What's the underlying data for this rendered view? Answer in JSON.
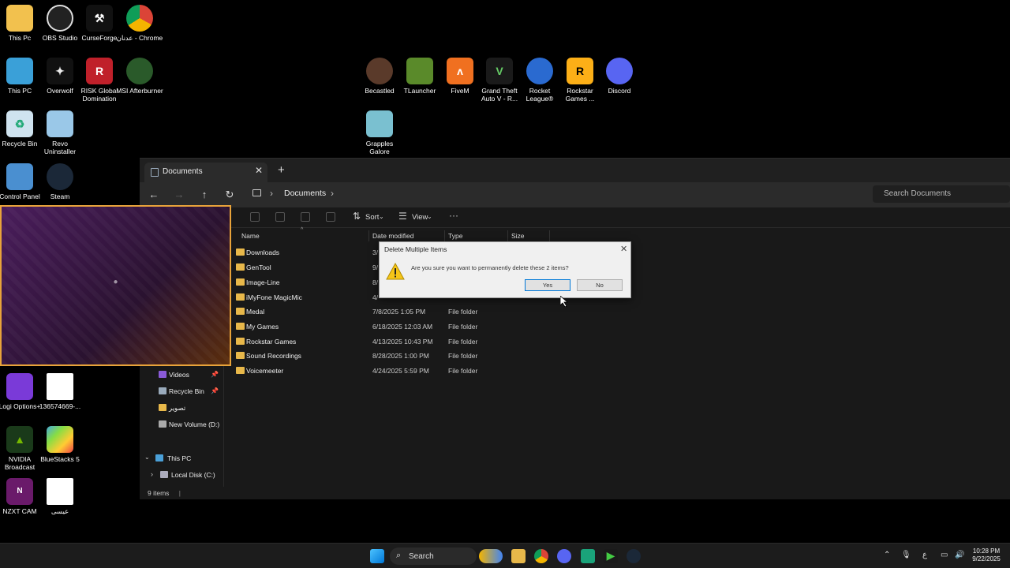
{
  "desktop": {
    "icons": [
      {
        "label": "This Pc"
      },
      {
        "label": "OBS Studio"
      },
      {
        "label": "CurseForge"
      },
      {
        "label": "عدنان - Chrome"
      },
      {
        "label": "This PC"
      },
      {
        "label": "Overwolf"
      },
      {
        "label": "RISK Global Domination"
      },
      {
        "label": "MSI Afterburner"
      },
      {
        "label": "Recycle Bin"
      },
      {
        "label": "Revo Uninstaller"
      },
      {
        "label": "Control Panel"
      },
      {
        "label": "Steam"
      },
      {
        "label": "Logi Options+"
      },
      {
        "label": "136574669-..."
      },
      {
        "label": "NVIDIA Broadcast"
      },
      {
        "label": "BlueStacks 5"
      },
      {
        "label": "NZXT CAM"
      },
      {
        "label": "عيسى"
      },
      {
        "label": "Becastled"
      },
      {
        "label": "TLauncher"
      },
      {
        "label": "FiveM"
      },
      {
        "label": "Grand Theft Auto V - R..."
      },
      {
        "label": "Rocket League®"
      },
      {
        "label": "Rockstar Games ..."
      },
      {
        "label": "Discord"
      },
      {
        "label": "Grapples Galore"
      }
    ]
  },
  "explorer": {
    "tab_title": "Documents",
    "breadcrumb": "Documents",
    "search_placeholder": "Search Documents",
    "commands": {
      "sort": "Sort",
      "view": "View"
    },
    "columns": {
      "name": "Name",
      "date": "Date modified",
      "type": "Type",
      "size": "Size"
    },
    "nav_items": [
      {
        "label": "Videos",
        "pinned": true
      },
      {
        "label": "Recycle Bin",
        "pinned": true
      },
      {
        "label": "تصوير",
        "pinned": false
      },
      {
        "label": "New Volume (D:)",
        "pinned": false
      },
      {
        "label": "This PC",
        "pinned": false
      },
      {
        "label": "Local Disk (C:)",
        "pinned": false
      }
    ],
    "files": [
      {
        "name": "Downloads",
        "date": "3/",
        "type": ""
      },
      {
        "name": "GenTool",
        "date": "9/",
        "type": ""
      },
      {
        "name": "Image-Line",
        "date": "8/",
        "type": ""
      },
      {
        "name": "iMyFone MagicMic",
        "date": "4/",
        "type": ""
      },
      {
        "name": "Medal",
        "date": "7/8/2025 1:05 PM",
        "type": "File folder"
      },
      {
        "name": "My Games",
        "date": "6/18/2025 12:03 AM",
        "type": "File folder"
      },
      {
        "name": "Rockstar Games",
        "date": "4/13/2025 10:43 PM",
        "type": "File folder"
      },
      {
        "name": "Sound Recordings",
        "date": "8/28/2025 1:00 PM",
        "type": "File folder"
      },
      {
        "name": "Voicemeeter",
        "date": "4/24/2025 5:59 PM",
        "type": "File folder"
      }
    ],
    "status": "9 items"
  },
  "dialog": {
    "title": "Delete Multiple Items",
    "message": "Are you sure you want to permanently delete these 2 items?",
    "yes": "Yes",
    "no": "No"
  },
  "taskbar": {
    "search_label": "Search",
    "lang": "ع",
    "time": "10:28 PM",
    "date": "9/22/2025"
  },
  "colors": {
    "folder": "#e8b84a",
    "webcam_border": "#e8a33a",
    "dialog_bg": "#f0f0f0",
    "accent": "#0078d7"
  }
}
